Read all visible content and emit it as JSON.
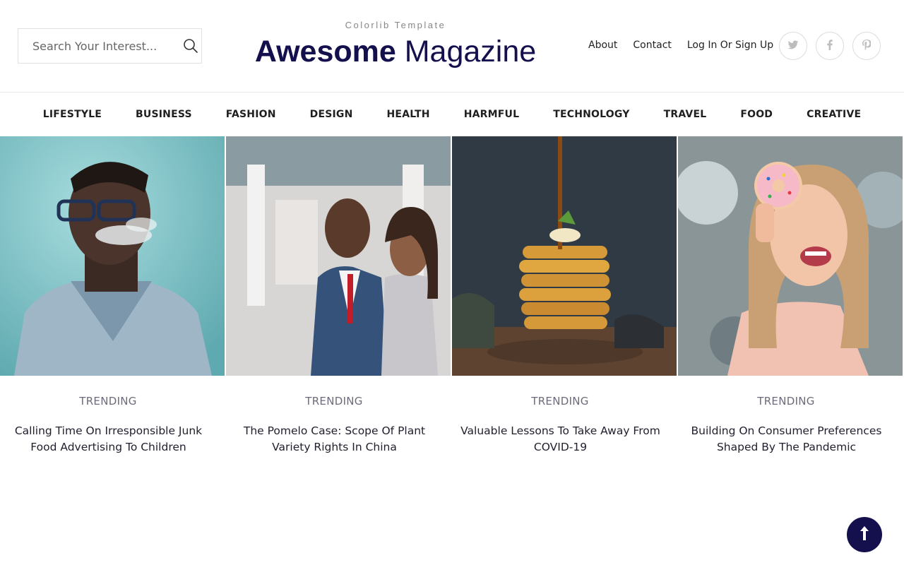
{
  "search": {
    "placeholder": "Search Your Interest..."
  },
  "brand": {
    "tagline": "Colorlib Template",
    "title_strong": "Awesome",
    "title_light": "Magazine"
  },
  "top_links": [
    "About",
    "Contact",
    "Log In Or Sign Up"
  ],
  "social": [
    "twitter-icon",
    "facebook-icon",
    "pinterest-icon"
  ],
  "nav": [
    "LIFESTYLE",
    "BUSINESS",
    "FASHION",
    "DESIGN",
    "HEALTH",
    "HARMFUL",
    "TECHNOLOGY",
    "TRAVEL",
    "FOOD",
    "CREATIVE"
  ],
  "cards": [
    {
      "category": "TRENDING",
      "title": "Calling Time On Irresponsible Junk Food Advertising To Children",
      "image": "man-with-glasses-smoking-photo"
    },
    {
      "category": "TRENDING",
      "title": "The Pomelo Case: Scope Of Plant Variety Rights In China",
      "image": "business-couple-photo"
    },
    {
      "category": "TRENDING",
      "title": "Valuable Lessons To Take Away From COVID-19",
      "image": "pancake-stack-syrup-photo"
    },
    {
      "category": "TRENDING",
      "title": "Building On Consumer Preferences Shaped By The Pandemic",
      "image": "woman-with-donut-photo"
    }
  ],
  "colors": {
    "brand": "#14104d",
    "category": "#6b6b7b",
    "border": "#e0e0e0"
  },
  "back_to_top": "arrow-up-icon"
}
